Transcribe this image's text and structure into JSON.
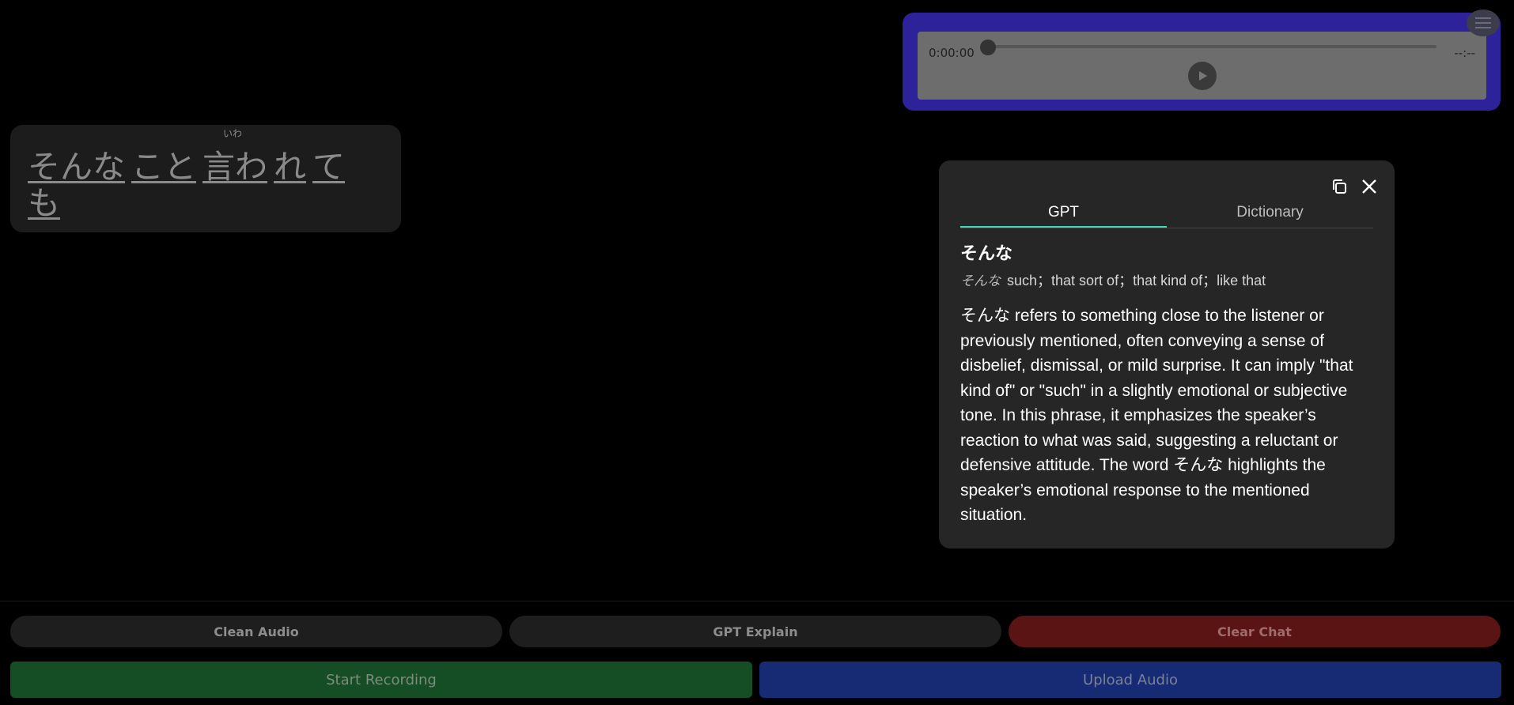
{
  "audio": {
    "current_time": "0:00:00",
    "duration": "--:--",
    "play_icon": "play-icon",
    "progress": 0
  },
  "menu": {
    "icon": "hamburger-menu-icon"
  },
  "transcript": {
    "ruby": "いわ",
    "words": [
      "そんな",
      "こと",
      "言わ",
      "れ",
      "て",
      "も"
    ]
  },
  "popup": {
    "copy_icon": "copy-icon",
    "close_icon": "close-icon",
    "tabs": [
      "GPT",
      "Dictionary"
    ],
    "active_tab": "GPT",
    "word": "そんな",
    "definition_kana": "そんな",
    "definition": "such；that sort of；that kind of；like that",
    "explanation": "そんな refers to something close to the listener or previously mentioned, often conveying a sense of disbelief, dismissal, or mild surprise. It can imply \"that kind of\" or \"such\" in a slightly emotional or subjective tone. In this phrase, it emphasizes the speaker’s reaction to what was said, suggesting a reluctant or defensive attitude. The word そんな highlights the speaker’s emotional response to the mentioned situation."
  },
  "controls": {
    "clean_audio": "Clean Audio",
    "gpt_explain": "GPT Explain",
    "clear_chat": "Clear Chat",
    "start_recording": "Start Recording",
    "upload_audio": "Upload Audio"
  },
  "colors": {
    "accent_tab": "#3ed8b5",
    "audio_frame": "#2e229a",
    "record": "#154d24",
    "upload": "#162b73",
    "clear": "#5a1414"
  }
}
